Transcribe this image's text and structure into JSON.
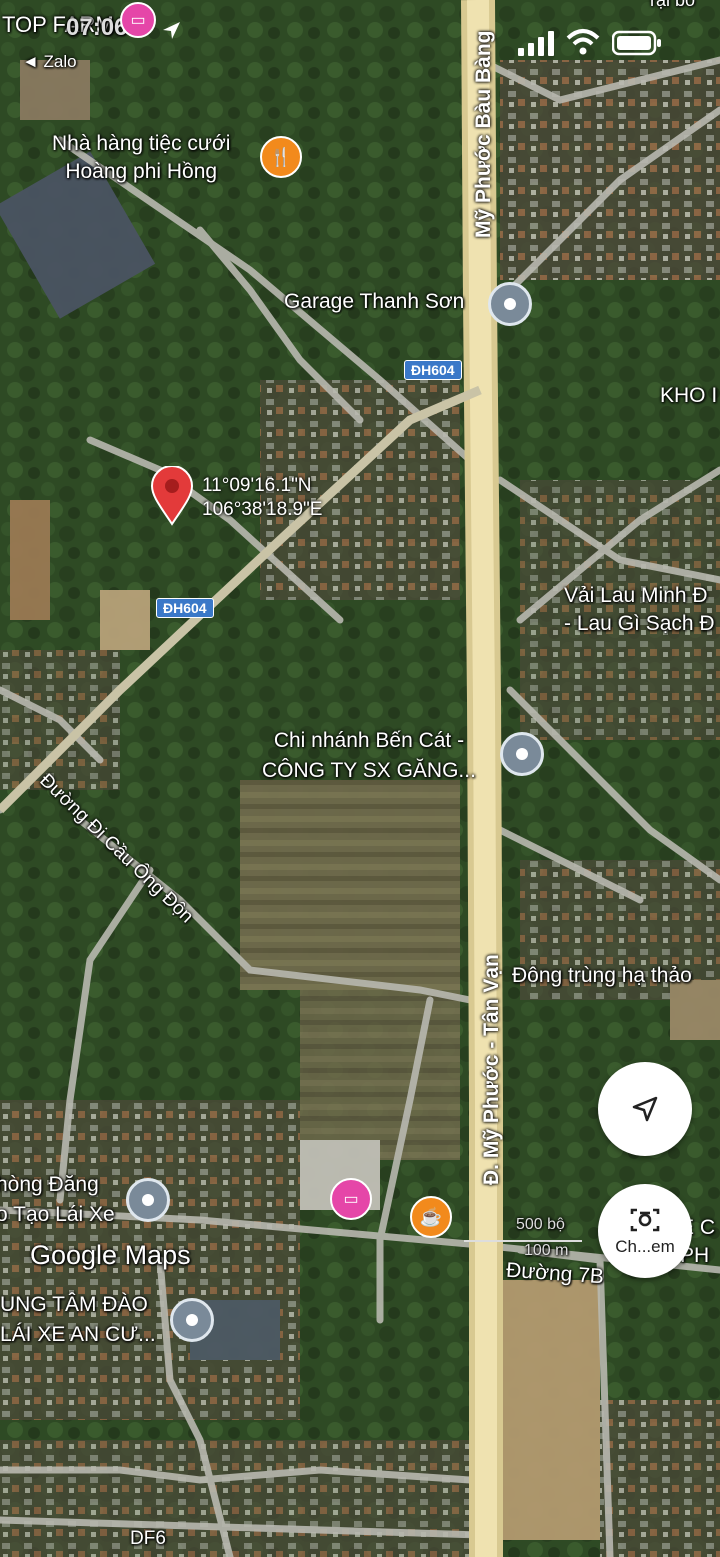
{
  "status": {
    "time": "07:06",
    "back_app": "◄ Zalo",
    "top_text": "TOP FARM"
  },
  "pin": {
    "lat": "11°09'16.1\"N",
    "lng": "106°38'18.9\"E",
    "color": "#e33a3a"
  },
  "roads": {
    "highway_north": "Mỹ Phước Bàu Bàng",
    "highway_south": "Đ. Mỹ Phước - Tân Vạn",
    "dh604_a": "ĐH604",
    "dh604_b": "ĐH604",
    "cau_ong_don": "Đường Đi Cầu Ông Độn",
    "duong_7b": "Đường 7B",
    "df6": "DF6"
  },
  "places": {
    "restaurant": [
      "Nhà hàng tiệc cưới",
      "Hoàng phi Hồng"
    ],
    "garage": "Garage Thanh Sơn",
    "kho": "KHO I",
    "vai_lau": [
      "Vải Lau Minh Đ",
      "- Lau Gì Sạch Đ"
    ],
    "chi_nhanh": [
      "Chi nhánh Bến Cát -",
      "CÔNG TY SX GĂNG..."
    ],
    "dong_trung": "Đông trùng hạ thảo",
    "phong_dang": [
      "hòng Đăng",
      "o Tạo Lái Xe"
    ],
    "trung_tam": [
      "UNG TÂM ĐÀO",
      "LÁI XE AN CƯ..."
    ],
    "partial_right": [
      "E C",
      "PH"
    ],
    "top_right_partial": "rại bò"
  },
  "map_brand": "Google Maps",
  "scale": {
    "top": "500 bộ",
    "bottom": "100 m"
  },
  "buttons": {
    "locate_icon": "navigation-arrow-icon",
    "camera_label": "Ch...em",
    "camera_icon": "camera-search-icon"
  },
  "colors": {
    "highway": "#e8d9a0",
    "road": "#b8b8b0",
    "shield": "#3a78c8"
  }
}
